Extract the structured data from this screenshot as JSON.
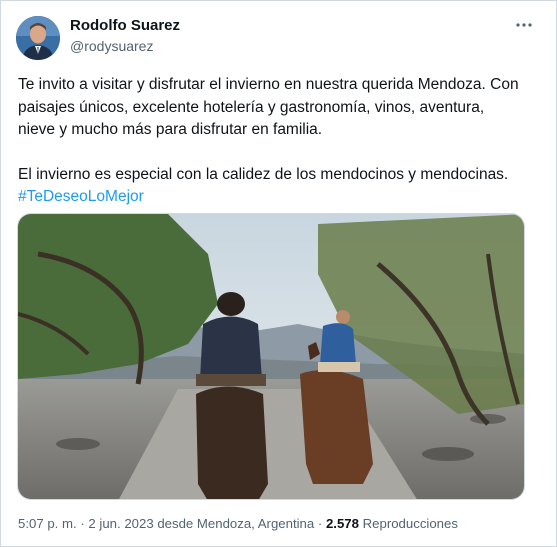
{
  "author": {
    "name": "Rodolfo Suarez",
    "handle": "@rodysuarez",
    "avatar_icon": "profile-photo"
  },
  "more_icon": "ellipsis-icon",
  "tweet": {
    "line1": "Te invito a visitar y disfrutar el invierno en nuestra querida Mendoza. Con",
    "line2": "paisajes únicos, excelente hotelería y gastronomía, vinos, aventura,",
    "line3": "nieve y mucho más para disfrutar en familia.",
    "line4": "El invierno es especial con la calidez de los mendocinos y mendocinas.",
    "hashtag": "#TeDeseoLoMejor"
  },
  "meta": {
    "time": "5:07 p. m.",
    "separator1": " · ",
    "date": "2 jun. 2023",
    "location": " desde Mendoza, Argentina",
    "separator2": " · ",
    "views_count": "2.578",
    "views_label": " Reproducciones"
  },
  "colors": {
    "link": "#1d9bf0",
    "secondary_text": "#536471",
    "border": "#cfd9de"
  }
}
